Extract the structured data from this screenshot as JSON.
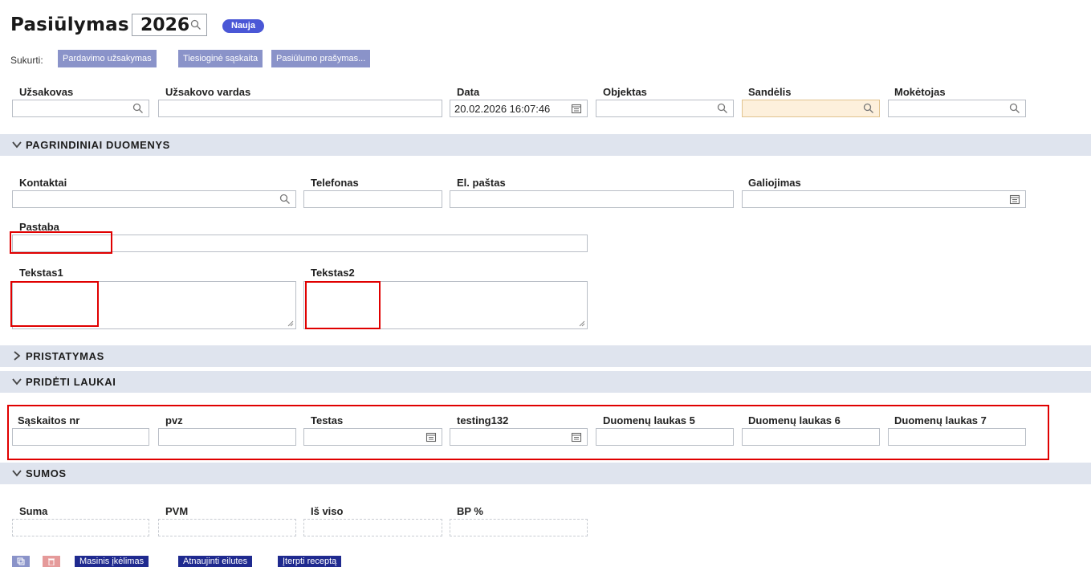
{
  "header": {
    "title": "Pasiūlymas",
    "number": "2026",
    "badge": "Nauja"
  },
  "sukurti": {
    "label": "Sukurti:",
    "buttons": [
      "Pardavimo užsakymas",
      "Tiesioginė sąskaita",
      "Pasiūlumo prašymas..."
    ]
  },
  "top_fields": {
    "uzsakovas": "Užsakovas",
    "uzsakovo_vardas": "Užsakovo vardas",
    "data": "Data",
    "data_value": "20.02.2026 16:07:46",
    "objektas": "Objektas",
    "sandelis": "Sandėlis",
    "moketojas": "Mokėtojas"
  },
  "sections": {
    "pagrindiniai": "PAGRINDINIAI DUOMENYS",
    "pristatymas": "PRISTATYMAS",
    "prideti": "PRIDĖTI LAUKAI",
    "sumos": "SUMOS"
  },
  "main_fields": {
    "kontaktai": "Kontaktai",
    "telefonas": "Telefonas",
    "el_pastas": "El. paštas",
    "galiojimas": "Galiojimas",
    "pastaba": "Pastaba",
    "tekstas1": "Tekstas1",
    "tekstas2": "Tekstas2"
  },
  "extra_fields": {
    "saskaitos_nr": "Sąskaitos nr",
    "pvz": "pvz",
    "testas": "Testas",
    "testing132": "testing132",
    "duom5": "Duomenų laukas 5",
    "duom6": "Duomenų laukas 6",
    "duom7": "Duomenų laukas 7"
  },
  "sumos": {
    "suma": "Suma",
    "pvm": "PVM",
    "is_viso": "Iš viso",
    "bp": "BP %"
  },
  "footer": {
    "buttons": [
      "Masinis įkėlimas",
      "Atnaujinti eilutes",
      "Įterpti receptą"
    ]
  },
  "colors": {
    "accent": "#4a57d6",
    "section_bg": "#dfe4ee",
    "highlight": "#e00000"
  }
}
